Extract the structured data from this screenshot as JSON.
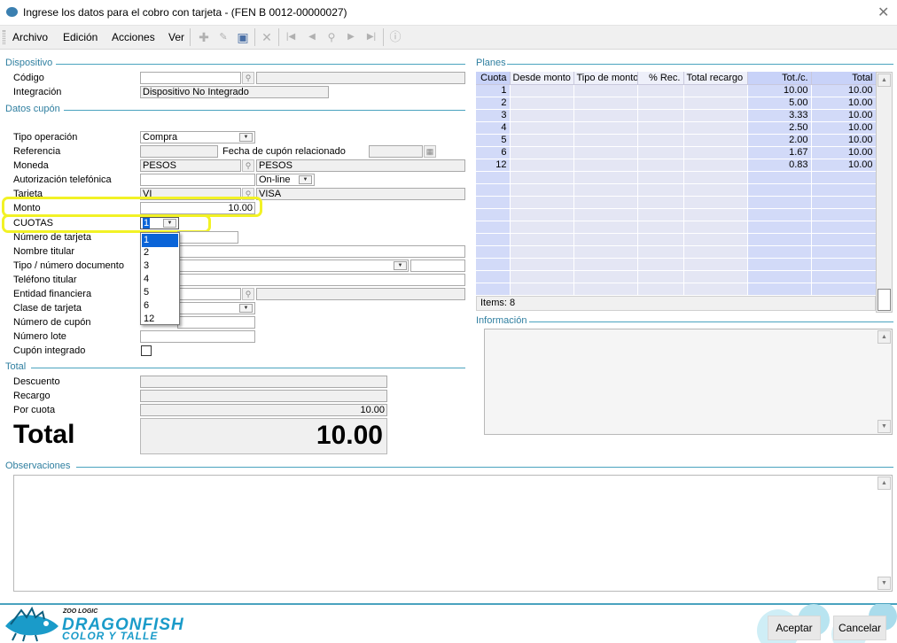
{
  "window": {
    "title": "Ingrese los datos para el cobro con tarjeta - (FEN B 0012-00000027)"
  },
  "menu": {
    "archivo": "Archivo",
    "edicion": "Edición",
    "acciones": "Acciones",
    "ver": "Ver"
  },
  "sections": {
    "dispositivo": "Dispositivo",
    "datos_cupon": "Datos cupón",
    "total": "Total",
    "observaciones": "Observaciones",
    "planes": "Planes",
    "informacion": "Información"
  },
  "dispositivo": {
    "codigo_label": "Código",
    "codigo_value": "",
    "integracion_label": "Integración",
    "integracion_value": "Dispositivo No Integrado"
  },
  "cupon": {
    "tipo_operacion_label": "Tipo operación",
    "tipo_operacion_value": "Compra",
    "referencia_label": "Referencia",
    "fecha_cupon_label": "Fecha de cupón relacionado",
    "moneda_label": "Moneda",
    "moneda_code": "PESOS",
    "moneda_desc": "PESOS",
    "autorizacion_label": "Autorización telefónica",
    "autorizacion_mode": "On-line",
    "tarjeta_label": "Tarjeta",
    "tarjeta_code": "VI",
    "tarjeta_desc": "VISA",
    "monto_label": "Monto",
    "monto_value": "10.00",
    "cuotas_label": "CUOTAS",
    "cuotas_value": "1",
    "numero_tarjeta_label": "Número de tarjeta",
    "nombre_titular_label": "Nombre titular",
    "tipo_documento_label": "Tipo / número documento",
    "telefono_label": "Teléfono titular",
    "entidad_label": "Entidad financiera",
    "clase_label": "Clase de tarjeta",
    "numero_cupon_label": "Número de cupón",
    "numero_lote_label": "Número lote",
    "cupon_integrado_label": "Cupón integrado"
  },
  "cuotas_options": [
    "1",
    "2",
    "3",
    "4",
    "5",
    "6",
    "12"
  ],
  "total": {
    "descuento_label": "Descuento",
    "recargo_label": "Recargo",
    "por_cuota_label": "Por cuota",
    "por_cuota_value": "10.00",
    "total_label": "Total",
    "total_value": "10.00"
  },
  "planes": {
    "headers": [
      "Cuota",
      "Desde monto",
      "Tipo de monto",
      "% Rec.",
      "Total recargo",
      "Tot./c.",
      "Total"
    ],
    "rows": [
      [
        "1",
        "",
        "",
        "",
        "",
        "10.00",
        "10.00"
      ],
      [
        "2",
        "",
        "",
        "",
        "",
        "5.00",
        "10.00"
      ],
      [
        "3",
        "",
        "",
        "",
        "",
        "3.33",
        "10.00"
      ],
      [
        "4",
        "",
        "",
        "",
        "",
        "2.50",
        "10.00"
      ],
      [
        "5",
        "",
        "",
        "",
        "",
        "2.00",
        "10.00"
      ],
      [
        "6",
        "",
        "",
        "",
        "",
        "1.67",
        "10.00"
      ],
      [
        "12",
        "",
        "",
        "",
        "",
        "0.83",
        "10.00"
      ]
    ],
    "items_text": "Items: 8"
  },
  "footer": {
    "logo_small": "ZOO LOGIC",
    "logo_main": "DRAGONFISH",
    "logo_sub": "COLOR Y TALLE",
    "aceptar": "Aceptar",
    "cancelar": "Cancelar"
  },
  "colors": {
    "accent": "#4aa3bf",
    "highlight": "#f2f225",
    "grid_blue": "#d2daf8",
    "selection": "#0a64d8"
  }
}
